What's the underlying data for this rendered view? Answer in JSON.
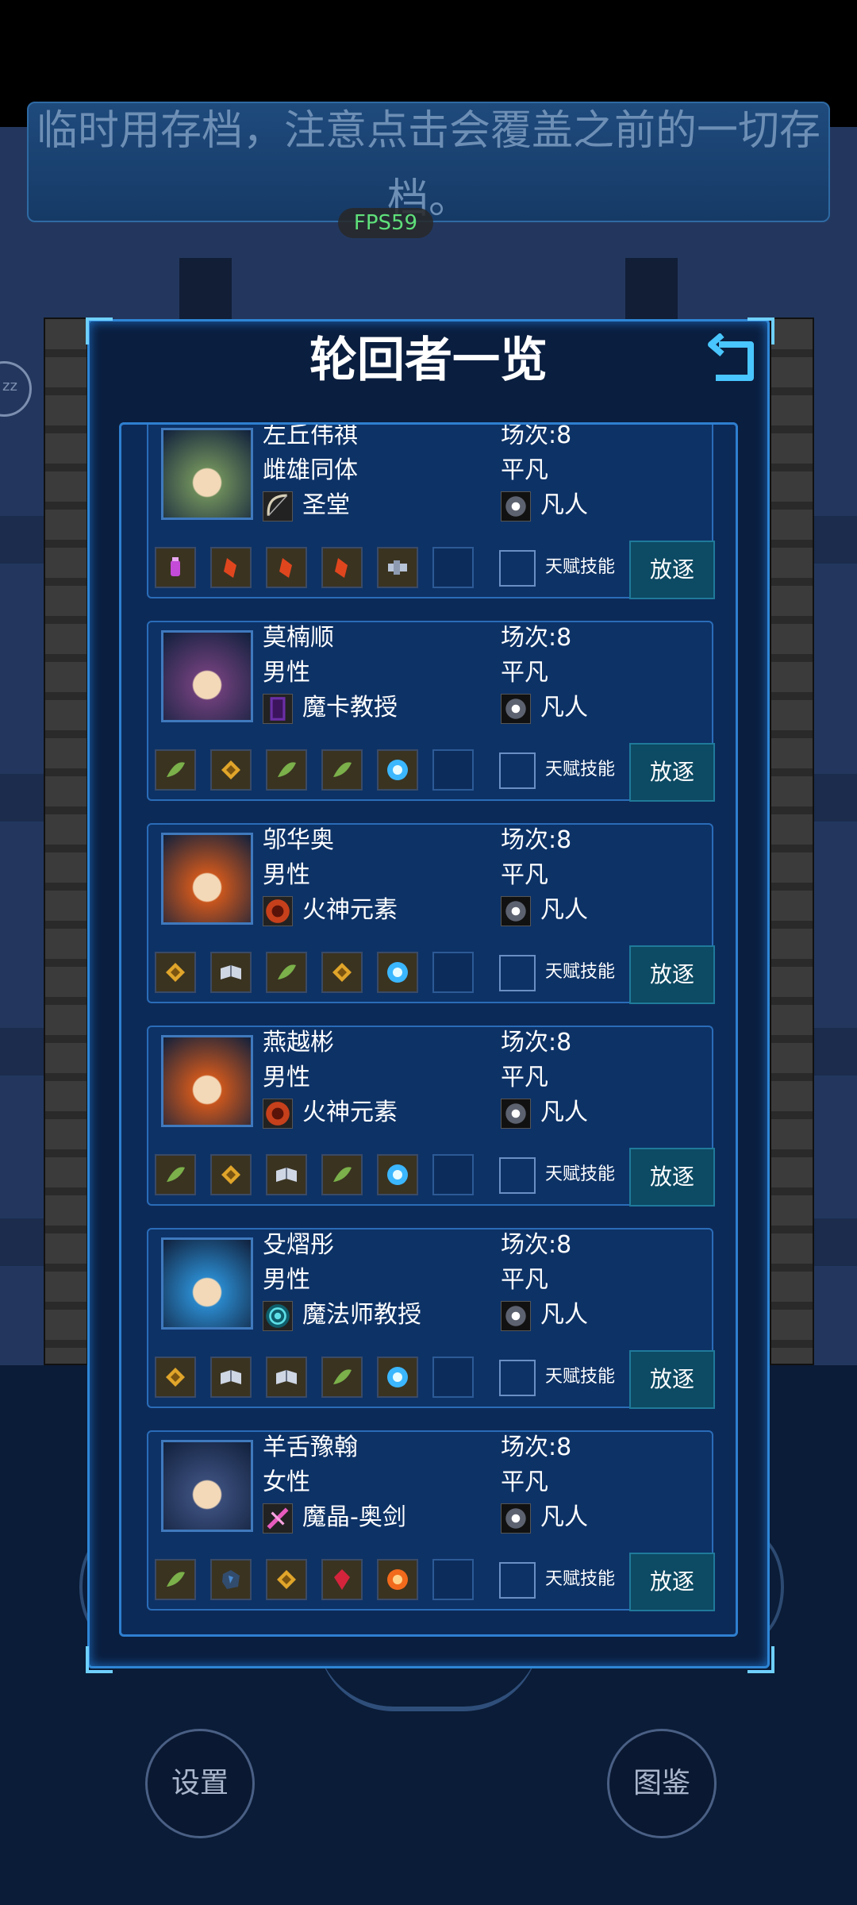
{
  "notice": {
    "text": "临时用存档，注意点击会覆盖之前的一切存档。"
  },
  "fps": "FPS59",
  "left_badge": "zz",
  "panel": {
    "title": "轮回者一览"
  },
  "talent_label": "天赋技能",
  "exile_label": "放逐",
  "characters": [
    {
      "name": "左丘伟祺",
      "gender": "雌雄同体",
      "class": "圣堂",
      "rounds": "场次:8",
      "quality": "平凡",
      "rank": "凡人",
      "portrait_color": "#6b8a5a",
      "class_icon": "bow-icon",
      "items": [
        "potion-icon",
        "crystal-red-icon",
        "crystal-red-icon",
        "crystal-red-icon",
        "gadget-icon"
      ]
    },
    {
      "name": "莫楠顺",
      "gender": "男性",
      "class": "魔卡教授",
      "rounds": "场次:8",
      "quality": "平凡",
      "rank": "凡人",
      "portrait_color": "#6a3e78",
      "class_icon": "card-icon",
      "items": [
        "leaf-icon",
        "amber-icon",
        "leaf-icon",
        "leaf-icon",
        "light-burst-icon"
      ]
    },
    {
      "name": "邬华奥",
      "gender": "男性",
      "class": "火神元素",
      "rounds": "场次:8",
      "quality": "平凡",
      "rank": "凡人",
      "portrait_color": "#c8561e",
      "class_icon": "fire-face-icon",
      "items": [
        "amber-icon",
        "book-icon",
        "leaf-icon",
        "amber-icon",
        "light-burst-icon"
      ]
    },
    {
      "name": "燕越彬",
      "gender": "男性",
      "class": "火神元素",
      "rounds": "场次:8",
      "quality": "平凡",
      "rank": "凡人",
      "portrait_color": "#c8561e",
      "class_icon": "fire-face-icon",
      "items": [
        "leaf-icon",
        "amber-icon",
        "book-icon",
        "leaf-icon",
        "light-burst-icon"
      ]
    },
    {
      "name": "殳熠彤",
      "gender": "男性",
      "class": "魔法师教授",
      "rounds": "场次:8",
      "quality": "平凡",
      "rank": "凡人",
      "portrait_color": "#2a87c9",
      "class_icon": "swirl-icon",
      "items": [
        "amber-icon",
        "book-icon",
        "book-icon",
        "leaf-icon",
        "light-burst-icon"
      ]
    },
    {
      "name": "羊舌豫翰",
      "gender": "女性",
      "class": "魔晶-奥剑",
      "rounds": "场次:8",
      "quality": "平凡",
      "rank": "凡人",
      "portrait_color": "#3a4d7a",
      "class_icon": "crystal-sword-icon",
      "items": [
        "leaf-icon",
        "ore-icon",
        "amber-icon",
        "ruby-icon",
        "fire-burst-icon"
      ]
    }
  ],
  "bottom": {
    "settings": "设置",
    "codex": "图鉴"
  },
  "colors": {
    "accent": "#2e86d6",
    "panel": "#0a1e3f",
    "card": "#0d3266",
    "exile": "#0d4a63"
  }
}
